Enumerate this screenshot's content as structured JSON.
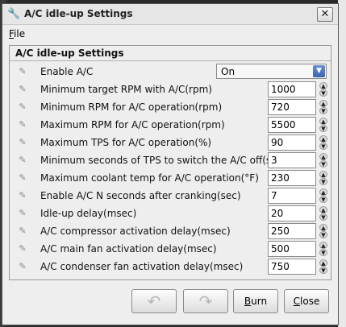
{
  "window": {
    "title": "A/C idle-up Settings",
    "close_glyph": "✕"
  },
  "menu": {
    "file": "File",
    "file_mnemonic": "F",
    "file_rest": "ile"
  },
  "panel": {
    "title": "A/C idle-up Settings",
    "rows": [
      {
        "label": "Enable A/C",
        "type": "select",
        "value": "On"
      },
      {
        "label": "Minimum target RPM with A/C(rpm)",
        "type": "number",
        "value": "1000"
      },
      {
        "label": "Minimum RPM for A/C operation(rpm)",
        "type": "number",
        "value": "720"
      },
      {
        "label": "Maximum RPM for A/C operation(rpm)",
        "type": "number",
        "value": "5500"
      },
      {
        "label": "Maximum TPS for A/C operation(%)",
        "type": "number",
        "value": "90"
      },
      {
        "label": "Minimum seconds of TPS to switch the A/C off(sec)",
        "type": "number",
        "value": "3"
      },
      {
        "label": "Maximum coolant temp for A/C operation(°F)",
        "type": "number",
        "value": "230"
      },
      {
        "label": "Enable A/C N seconds after cranking(sec)",
        "type": "number",
        "value": "7"
      },
      {
        "label": "Idle-up delay(msec)",
        "type": "number",
        "value": "20"
      },
      {
        "label": "A/C compressor activation delay(msec)",
        "type": "number",
        "value": "250"
      },
      {
        "label": "A/C main fan activation delay(msec)",
        "type": "number",
        "value": "500"
      },
      {
        "label": "A/C condenser fan activation delay(msec)",
        "type": "number",
        "value": "750"
      }
    ]
  },
  "buttons": {
    "undo_glyph": "↶",
    "redo_glyph": "↷",
    "burn_mnemonic": "B",
    "burn_rest": "urn",
    "close_mnemonic": "C",
    "close_rest": "lose"
  },
  "icons": {
    "app": "settings-app-icon",
    "row": "pencil-edit-icon"
  }
}
